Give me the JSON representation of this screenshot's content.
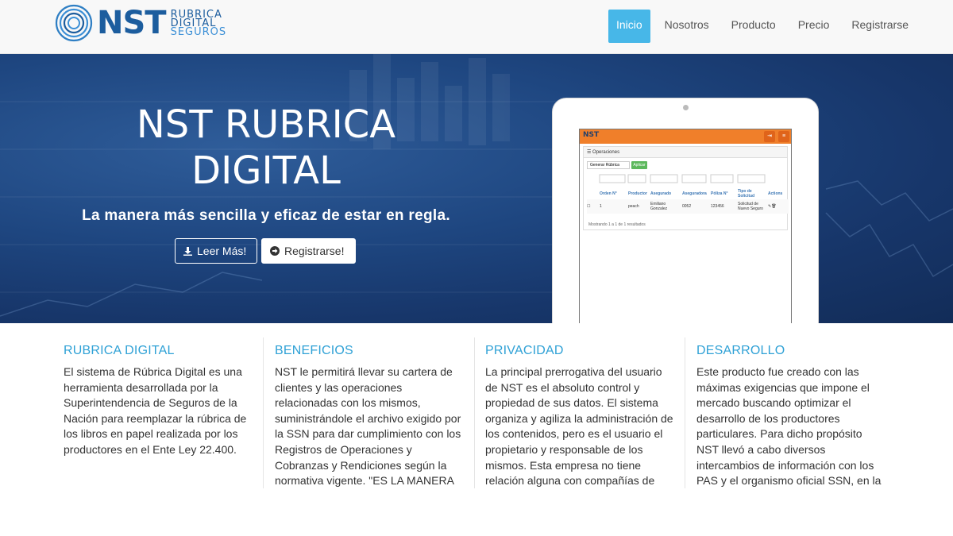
{
  "brand": {
    "name": "NST",
    "sub_line1": "RUBRICA",
    "sub_line2": "DIGITAL",
    "sub_line3": "SEGUROS"
  },
  "nav": {
    "items": [
      {
        "label": "Inicio",
        "active": true
      },
      {
        "label": "Nosotros",
        "active": false
      },
      {
        "label": "Producto",
        "active": false
      },
      {
        "label": "Precio",
        "active": false
      },
      {
        "label": "Registrarse",
        "active": false
      }
    ]
  },
  "hero": {
    "title_line1": "NST RUBRICA",
    "title_line2": "DIGITAL",
    "subtitle": "La manera más sencilla y eficaz de estar en regla.",
    "btn_more": "Leer Más!",
    "btn_register": "Registrarse!"
  },
  "tablet": {
    "app_logo": "NST",
    "panel_title": "Operaciones",
    "select_value": "Generar Rúbrica",
    "apply_label": "Aplicar",
    "columns": [
      "Orden N°",
      "Productor",
      "Asegurado",
      "Aseguradora",
      "Póliza N°",
      "Tipo de Solicitud",
      "Actions"
    ],
    "row": [
      "1",
      "peach",
      "Emiliano Gonzalez",
      "0052",
      "123456",
      "Solicitud de Nuevo Seguro"
    ],
    "footer": "Mostrando 1 a 1 de 1 resultados"
  },
  "columns": [
    {
      "title": "RUBRICA DIGITAL",
      "text": "El sistema de Rúbrica Digital es una herramienta desarrollada por la Superintendencia de Seguros de la Nación para reemplazar la rúbrica de los libros en papel realizada por los productores en el Ente Ley 22.400."
    },
    {
      "title": "BENEFICIOS",
      "text": "NST le permitirá llevar su cartera de clientes y las operaciones relacionadas con los mismos, suministrándole el archivo exigido por la SSN para dar cumplimiento con los Registros de Operaciones y Cobranzas y Rendiciones según la normativa vigente. \"ES LA MANERA"
    },
    {
      "title": "PRIVACIDAD",
      "text": "La principal prerrogativa del usuario de NST es el absoluto control y propiedad de sus datos. El sistema organiza y agiliza la administración de los contenidos, pero es el usuario el propietario y responsable de los mismos. Esta empresa no tiene relación alguna con compañías de"
    },
    {
      "title": "DESARROLLO",
      "text": "Este producto fue creado con las máximas exigencias que impone el mercado buscando optimizar el desarrollo de los productores particulares. Para dicho propósito NST llevó a cabo diversos intercambios de información con los PAS y el organismo oficial SSN, en la"
    }
  ],
  "colors": {
    "accent": "#47b7e8",
    "title_blue": "#2fa1d6",
    "brand_blue": "#1c5d9e",
    "hero_bg": "#1e4680",
    "app_orange": "#f07f2a"
  }
}
